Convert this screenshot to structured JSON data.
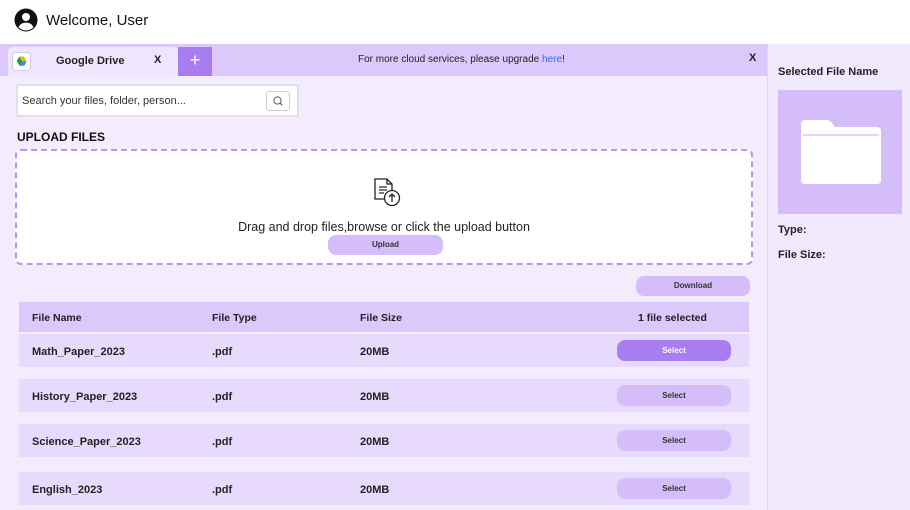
{
  "header": {
    "welcome": "Welcome, User"
  },
  "tabs": {
    "active_label": "Google Drive",
    "close_label": "X",
    "add_label": "+"
  },
  "banner": {
    "text_before": "For more cloud services, please upgrade ",
    "link": "here",
    "text_after": "!",
    "close_label": "X"
  },
  "search": {
    "placeholder": "Search your files, folder, person..."
  },
  "upload": {
    "title": "UPLOAD FILES",
    "instructions": "Drag and drop files,browse or click the upload button",
    "button": "Upload"
  },
  "download_button": "Download",
  "table": {
    "headers": [
      "File Name",
      "File Type",
      "File Size",
      "1 file selected"
    ],
    "rows": [
      {
        "name": "Math_Paper_2023",
        "type": ".pdf",
        "size": "20MB",
        "action": "Select",
        "selected": true
      },
      {
        "name": "History_Paper_2023",
        "type": ".pdf",
        "size": "20MB",
        "action": "Select",
        "selected": false
      },
      {
        "name": "Science_Paper_2023",
        "type": ".pdf",
        "size": "20MB",
        "action": "Select",
        "selected": false
      },
      {
        "name": "English_2023",
        "type": ".pdf",
        "size": "20MB",
        "action": "Select",
        "selected": false
      }
    ]
  },
  "side_panel": {
    "title": "Selected File Name",
    "type_label": "Type:",
    "size_label": "File Size:"
  },
  "icons": {
    "user": "user-circle-icon",
    "drive": "google-drive-icon",
    "search": "search-icon",
    "upload": "file-upload-icon",
    "folder": "folder-icon"
  },
  "colors": {
    "accent": "#a77df0",
    "light_accent": "#d4bdf8",
    "tab_bar": "#dcc8fb",
    "background": "#f3ecfd",
    "link": "#2d6fe3"
  }
}
